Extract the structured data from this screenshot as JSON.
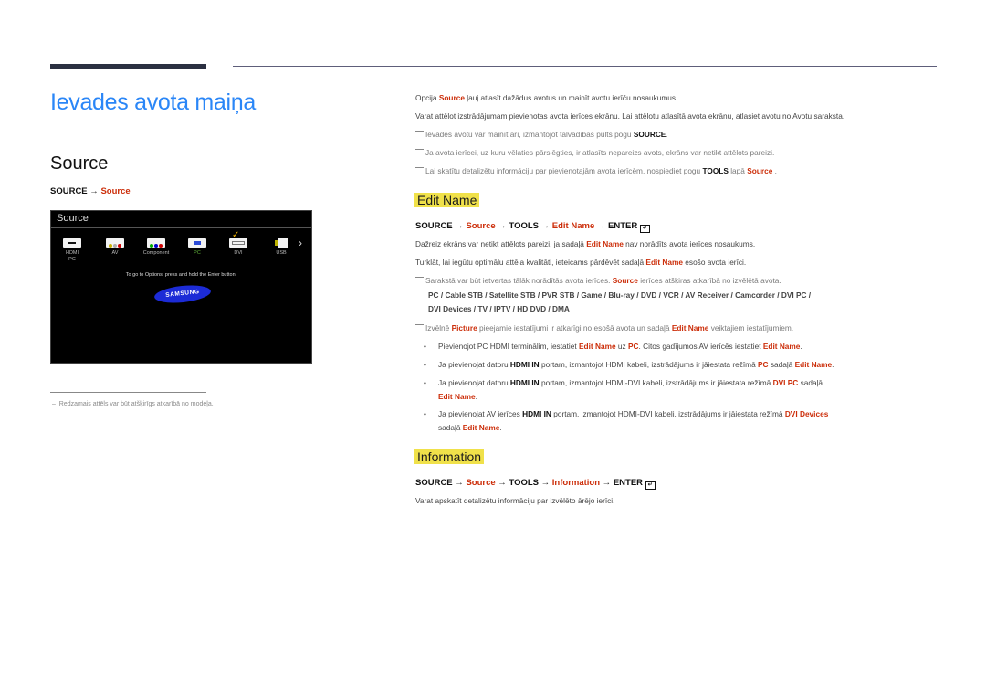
{
  "header": {
    "title": "Ievades avota maiņa"
  },
  "left": {
    "section_title": "Source",
    "path": {
      "root": "SOURCE",
      "arrow": "→",
      "item": "Source"
    },
    "tv_screen": {
      "title": "Source",
      "items": [
        {
          "label": "HDMI",
          "sub": "PC",
          "icon": "hdmi-icon"
        },
        {
          "label": "AV",
          "icon": "av-icon"
        },
        {
          "label": "Component",
          "icon": "component-icon"
        },
        {
          "label": "PC",
          "icon": "pc-icon",
          "active": true
        },
        {
          "label": "DVI",
          "icon": "dvi-icon"
        },
        {
          "label": "USB",
          "icon": "usb-icon"
        }
      ],
      "check": "✓",
      "next": "›",
      "hint": "To go to Options, press and hold the Enter button.",
      "logo": "SAMSUNG"
    },
    "footnote": "Redzamais attēls var būt atšķirīgs atkarībā no modeļa."
  },
  "intro": {
    "p1": {
      "a": "Opcija ",
      "b": "Source",
      "c": " ļauj atlasīt dažādus avotus un mainīt avotu ierīču nosaukumus."
    },
    "p2": "Varat attēlot izstrādājumam pievienotas avota ierīces ekrānu. Lai attēlotu atlasītā avota ekrānu, atlasiet avotu no Avotu saraksta.",
    "n1": {
      "a": "Ievades avotu var mainīt arī, izmantojot tālvadības pults pogu ",
      "b": "SOURCE",
      "c": "."
    },
    "n2": "Ja avota ierīcei, uz kuru vēlaties pārslēgties, ir atlasīts nepareizs avots, ekrāns var netikt attēlots pareizi.",
    "n3": {
      "a": "Lai skatītu detalizētu informāciju par pievienotajām avota ierīcēm, nospiediet pogu ",
      "b": "TOOLS",
      "c": " lapā ",
      "d": "Source",
      "e": " ."
    }
  },
  "edit_name": {
    "heading": "Edit Name",
    "path": {
      "root": "SOURCE",
      "s1": "Source",
      "tools": "TOOLS",
      "s2": "Edit Name",
      "enter": "ENTER",
      "arrow": "→"
    },
    "p1": {
      "a": "Dažreiz ekrāns var netikt attēlots pareizi, ja sadaļā ",
      "b": "Edit Name",
      "c": " nav norādīts avota ierīces nosaukums."
    },
    "p2": {
      "a": "Turklāt, lai iegūtu optimālu attēla kvalitāti, ieteicams pārdēvēt sadaļā ",
      "b": "Edit Name",
      "c": " esošo avota ierīci."
    },
    "n1": {
      "a": "Sarakstā var būt ietvertas tālāk norādītās avota ierīces. ",
      "b": "Source",
      "c": " ierīces atšķiras atkarībā no izvēlētā avota."
    },
    "devices_line1": "PC / Cable STB / Satellite STB / PVR STB / Game / Blu-ray / DVD / VCR / AV Receiver / Camcorder / DVI PC /",
    "devices_line2": "DVI Devices / TV / IPTV / HD DVD / DMA",
    "n2": {
      "a": "Izvēlnē ",
      "b": "Picture",
      "c": " pieejamie iestatījumi ir atkarīgi no esošā avota un sadaļā ",
      "d": "Edit Name",
      "e": " veiktajiem iestatījumiem."
    },
    "bullets": [
      {
        "a": "Pievienojot PC HDMI terminālim, iestatiet ",
        "b": "Edit Name",
        "c": " uz ",
        "d": "PC",
        "e": ". Citos gadījumos AV ierīcēs iestatiet ",
        "f": "Edit Name",
        "g": "."
      },
      {
        "a": "Ja pievienojat datoru ",
        "b": "HDMI IN",
        "c": " portam, izmantojot HDMI kabeli, izstrādājums ir jāiestata režīmā ",
        "d": "PC",
        "e": " sadaļā ",
        "f": "Edit Name",
        "g": "."
      },
      {
        "a": "Ja pievienojat datoru ",
        "b": "HDMI IN",
        "c": "  portam, izmantojot HDMI-DVI kabeli, izstrādājums ir jāiestata režīmā ",
        "d": "DVI PC",
        "e": " sadaļā",
        "f": "Edit Name",
        "g": "."
      },
      {
        "a": "Ja pievienojat AV ierīces ",
        "b": "HDMI IN",
        "c": "  portam, izmantojot HDMI-DVI kabeli, izstrādājums ir jāiestata režīmā ",
        "d": "DVI Devices",
        "e": "sadaļā ",
        "f": "Edit Name",
        "g": "."
      }
    ]
  },
  "information": {
    "heading": "Information",
    "path": {
      "root": "SOURCE",
      "s1": "Source",
      "tools": "TOOLS",
      "s2": "Information",
      "enter": "ENTER",
      "arrow": "→"
    },
    "p1": "Varat apskatīt detalizētu informāciju par izvēlēto ārējo ierīci."
  },
  "colors": {
    "title_blue": "#2a86f7",
    "accent_red": "#cc2e0a",
    "highlight_yellow": "#f0e14a"
  }
}
